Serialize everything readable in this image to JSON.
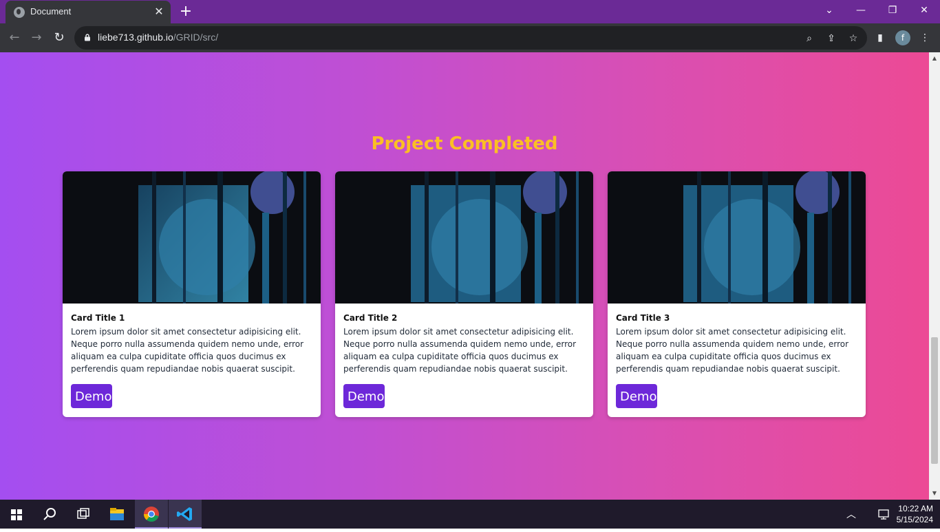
{
  "browser": {
    "tab_title": "Document",
    "url_host": "liebe713.github.io",
    "url_path": "/GRID/src/",
    "profile_initial": "f",
    "accent": "#6b2a96"
  },
  "page": {
    "heading": "Project Completed",
    "heading_color": "#fbbf24",
    "cards": [
      {
        "title": "Card Title 1",
        "text": "Lorem ipsum dolor sit amet consectetur adipisicing elit. Neque porro nulla assumenda quidem nemo unde, error aliquam ea culpa cupiditate officia quos ducimus ex perferendis quam repudiandae nobis quaerat suscipit.",
        "button": "Demo"
      },
      {
        "title": "Card Title 2",
        "text": "Lorem ipsum dolor sit amet consectetur adipisicing elit. Neque porro nulla assumenda quidem nemo unde, error aliquam ea culpa cupiditate officia quos ducimus ex perferendis quam repudiandae nobis quaerat suscipit.",
        "button": "Demo"
      },
      {
        "title": "Card Title 3",
        "text": "Lorem ipsum dolor sit amet consectetur adipisicing elit. Neque porro nulla assumenda quidem nemo unde, error aliquam ea culpa cupiditate officia quos ducimus ex perferendis quam repudiandae nobis quaerat suscipit.",
        "button": "Demo"
      }
    ]
  },
  "taskbar": {
    "time": "10:22 AM",
    "date": "5/15/2024",
    "apps": [
      "start-icon",
      "search-icon",
      "task-view-icon",
      "file-explorer-icon",
      "chrome-icon",
      "vscode-icon"
    ]
  }
}
